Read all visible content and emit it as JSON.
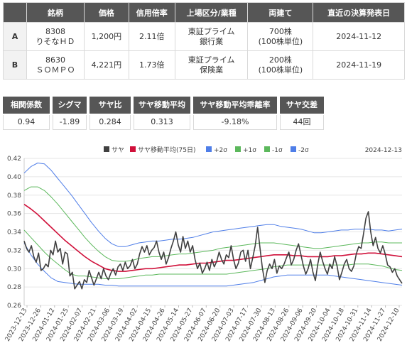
{
  "table": {
    "headers": [
      "",
      "銘柄",
      "価格",
      "信用倍率",
      "上場区分/業種",
      "両建て",
      "直近の決算発表日"
    ],
    "rows": [
      {
        "label": "A",
        "code": "8308",
        "name": "りそなＨＤ",
        "price": "1,200円",
        "ratio": "2.11倍",
        "market": "東証プライム",
        "sector": "銀行業",
        "shares": "700株",
        "unit": "(100株単位)",
        "date": "2024-11-12"
      },
      {
        "label": "B",
        "code": "8630",
        "name": "ＳＯＭＰＯ",
        "price": "4,221円",
        "ratio": "1.73倍",
        "market": "東証プライム",
        "sector": "保険業",
        "shares": "200株",
        "unit": "(100株単位)",
        "date": "2024-11-19"
      }
    ]
  },
  "stats": [
    {
      "label": "相関係数",
      "value": "0.94"
    },
    {
      "label": "シグマ",
      "value": "-1.89"
    },
    {
      "label": "サヤ比",
      "value": "0.284"
    },
    {
      "label": "サヤ移動平均",
      "value": "0.313"
    },
    {
      "label": "サヤ移動平均乖離率",
      "value": "-9.18%"
    },
    {
      "label": "サヤ交差",
      "value": "44回"
    }
  ],
  "chart_data": {
    "type": "line",
    "date_label": "2024-12-13",
    "ylim": [
      0.26,
      0.42
    ],
    "yticks": [
      "0.42",
      "0.40",
      "0.38",
      "0.36",
      "0.34",
      "0.32",
      "0.30",
      "0.28",
      "0.26"
    ],
    "xticks": [
      "2023-12-13",
      "2023-12-26",
      "2024-01-12",
      "2024-01-25",
      "2024-02-07",
      "2024-02-21",
      "2024-03-06",
      "2024-03-19",
      "2024-04-02",
      "2024-04-15",
      "2024-04-26",
      "2024-05-14",
      "2024-05-27",
      "2024-06-07",
      "2024-06-20",
      "2024-07-03",
      "2024-07-17",
      "2024-07-30",
      "2024-08-13",
      "2024-08-26",
      "2024-09-06",
      "2024-09-20",
      "2024-10-04",
      "2024-10-18",
      "2024-10-31",
      "2024-11-14",
      "2024-11-27",
      "2024-12-10"
    ],
    "legend": [
      {
        "name": "サヤ",
        "color": "#404040"
      },
      {
        "name": "サヤ移動平均(75日)",
        "color": "#d0103a"
      },
      {
        "name": "+2σ",
        "color": "#4f7ee8"
      },
      {
        "name": "+1σ",
        "color": "#5cb85c"
      },
      {
        "name": "-1σ",
        "color": "#5cb85c"
      },
      {
        "name": "-2σ",
        "color": "#4f7ee8"
      }
    ],
    "series": [
      {
        "name": "サヤ",
        "color": "#404040",
        "values": [
          0.33,
          0.322,
          0.318,
          0.325,
          0.313,
          0.307,
          0.317,
          0.298,
          0.3,
          0.305,
          0.302,
          0.32,
          0.315,
          0.33,
          0.318,
          0.322,
          0.305,
          0.318,
          0.316,
          0.292,
          0.296,
          0.278,
          0.282,
          0.286,
          0.278,
          0.288,
          0.285,
          0.298,
          0.29,
          0.282,
          0.289,
          0.296,
          0.289,
          0.3,
          0.292,
          0.288,
          0.295,
          0.3,
          0.293,
          0.302,
          0.305,
          0.298,
          0.307,
          0.3,
          0.303,
          0.31,
          0.3,
          0.305,
          0.316,
          0.324,
          0.318,
          0.325,
          0.315,
          0.32,
          0.323,
          0.33,
          0.318,
          0.31,
          0.318,
          0.305,
          0.312,
          0.322,
          0.33,
          0.34,
          0.326,
          0.318,
          0.335,
          0.322,
          0.33,
          0.318,
          0.325,
          0.31,
          0.3,
          0.306,
          0.295,
          0.3,
          0.307,
          0.298,
          0.31,
          0.302,
          0.308,
          0.318,
          0.31,
          0.305,
          0.315,
          0.312,
          0.325,
          0.31,
          0.3,
          0.306,
          0.318,
          0.32,
          0.308,
          0.32,
          0.3,
          0.312,
          0.325,
          0.345,
          0.322,
          0.3,
          0.285,
          0.298,
          0.305,
          0.3,
          0.31,
          0.295,
          0.303,
          0.3,
          0.305,
          0.312,
          0.318,
          0.304,
          0.31,
          0.32,
          0.327,
          0.315,
          0.303,
          0.294,
          0.3,
          0.31,
          0.296,
          0.287,
          0.305,
          0.318,
          0.308,
          0.3,
          0.294,
          0.305,
          0.3,
          0.313,
          0.303,
          0.288,
          0.296,
          0.305,
          0.31,
          0.3,
          0.297,
          0.303,
          0.316,
          0.324,
          0.322,
          0.338,
          0.355,
          0.362,
          0.34,
          0.325,
          0.334,
          0.322,
          0.317,
          0.325,
          0.316,
          0.304,
          0.302,
          0.296,
          0.3,
          0.292,
          0.288,
          0.284
        ]
      },
      {
        "name": "サヤ移動平均(75日)",
        "color": "#d0103a",
        "values": [
          0.37,
          0.365,
          0.359,
          0.352,
          0.345,
          0.338,
          0.331,
          0.325,
          0.319,
          0.313,
          0.308,
          0.304,
          0.3,
          0.298,
          0.297,
          0.297,
          0.298,
          0.299,
          0.3,
          0.3,
          0.301,
          0.302,
          0.303,
          0.304,
          0.304,
          0.305,
          0.306,
          0.306,
          0.307,
          0.308,
          0.309,
          0.309,
          0.31,
          0.311,
          0.312,
          0.313,
          0.314,
          0.315,
          0.315,
          0.315,
          0.314,
          0.314,
          0.313,
          0.313,
          0.313,
          0.313,
          0.314,
          0.314,
          0.315,
          0.316,
          0.316,
          0.317,
          0.317,
          0.316,
          0.315,
          0.314,
          0.313
        ]
      },
      {
        "name": "+2σ",
        "color": "#4f7ee8",
        "values": [
          0.404,
          0.411,
          0.415,
          0.414,
          0.407,
          0.398,
          0.389,
          0.38,
          0.37,
          0.36,
          0.35,
          0.341,
          0.333,
          0.327,
          0.324,
          0.324,
          0.326,
          0.328,
          0.329,
          0.33,
          0.33,
          0.331,
          0.332,
          0.332,
          0.333,
          0.334,
          0.336,
          0.338,
          0.34,
          0.341,
          0.342,
          0.343,
          0.344,
          0.345,
          0.346,
          0.347,
          0.348,
          0.348,
          0.346,
          0.345,
          0.344,
          0.343,
          0.341,
          0.339,
          0.339,
          0.34,
          0.341,
          0.342,
          0.342,
          0.343,
          0.343,
          0.343,
          0.342,
          0.342,
          0.341,
          0.342,
          0.343
        ]
      },
      {
        "name": "+1σ",
        "color": "#5cb85c",
        "values": [
          0.385,
          0.389,
          0.389,
          0.385,
          0.378,
          0.37,
          0.361,
          0.352,
          0.343,
          0.334,
          0.326,
          0.319,
          0.313,
          0.309,
          0.308,
          0.308,
          0.309,
          0.311,
          0.312,
          0.313,
          0.313,
          0.314,
          0.315,
          0.316,
          0.316,
          0.317,
          0.318,
          0.319,
          0.32,
          0.322,
          0.323,
          0.324,
          0.325,
          0.326,
          0.327,
          0.328,
          0.328,
          0.328,
          0.327,
          0.326,
          0.325,
          0.324,
          0.323,
          0.322,
          0.322,
          0.323,
          0.324,
          0.325,
          0.326,
          0.327,
          0.328,
          0.328,
          0.329,
          0.329,
          0.328,
          0.328,
          0.328
        ]
      },
      {
        "name": "-1σ",
        "color": "#5cb85c",
        "values": [
          0.342,
          0.334,
          0.326,
          0.318,
          0.311,
          0.305,
          0.299,
          0.294,
          0.292,
          0.292,
          0.291,
          0.29,
          0.289,
          0.289,
          0.289,
          0.29,
          0.291,
          0.292,
          0.293,
          0.293,
          0.294,
          0.294,
          0.294,
          0.294,
          0.294,
          0.294,
          0.294,
          0.294,
          0.294,
          0.294,
          0.294,
          0.295,
          0.296,
          0.297,
          0.298,
          0.299,
          0.3,
          0.302,
          0.303,
          0.304,
          0.304,
          0.304,
          0.304,
          0.304,
          0.304,
          0.304,
          0.304,
          0.304,
          0.304,
          0.305,
          0.305,
          0.305,
          0.304,
          0.303,
          0.301,
          0.299,
          0.298
        ]
      },
      {
        "name": "-2σ",
        "color": "#4f7ee8",
        "values": [
          0.328,
          0.315,
          0.305,
          0.297,
          0.29,
          0.286,
          0.285,
          0.284,
          0.283,
          0.283,
          0.283,
          0.283,
          0.282,
          0.282,
          0.281,
          0.281,
          0.281,
          0.281,
          0.281,
          0.281,
          0.281,
          0.281,
          0.281,
          0.281,
          0.281,
          0.281,
          0.281,
          0.281,
          0.281,
          0.281,
          0.281,
          0.282,
          0.283,
          0.284,
          0.285,
          0.287,
          0.289,
          0.291,
          0.292,
          0.293,
          0.293,
          0.293,
          0.293,
          0.293,
          0.293,
          0.293,
          0.292,
          0.291,
          0.29,
          0.289,
          0.288,
          0.287,
          0.286,
          0.285,
          0.284,
          0.283,
          0.282
        ]
      }
    ]
  }
}
